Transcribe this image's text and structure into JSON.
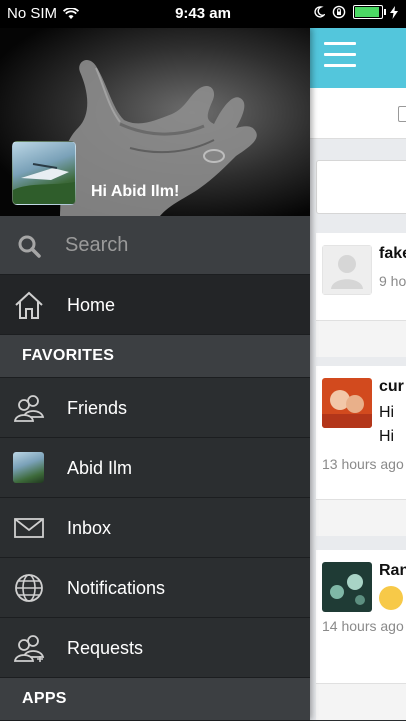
{
  "status_bar": {
    "carrier": "No SIM",
    "time": "9:43 am",
    "battery_level": 0.85,
    "battery_color": "#4cd964"
  },
  "profile": {
    "greeting": "Hi Abid Ilm!"
  },
  "search": {
    "placeholder": "Search"
  },
  "menu": {
    "home_label": "Home",
    "favorites_header": "FAVORITES",
    "items": [
      {
        "label": "Friends",
        "icon": "friends-icon"
      },
      {
        "label": "Abid Ilm",
        "icon": "avatar"
      },
      {
        "label": "Inbox",
        "icon": "envelope-icon"
      },
      {
        "label": "Notifications",
        "icon": "globe-icon"
      },
      {
        "label": "Requests",
        "icon": "friend-requests-icon"
      }
    ],
    "apps_header": "APPS"
  },
  "feed": {
    "accent_color": "#53c6dc",
    "posts": [
      {
        "name": "fake",
        "text": [],
        "time": "9 ho"
      },
      {
        "name": "cur",
        "text": [
          "Hi",
          "Hi"
        ],
        "time": "13 hours ago"
      },
      {
        "name": "Ran",
        "text": [],
        "time": "14 hours ago",
        "emoji": "grinning-face"
      }
    ]
  }
}
